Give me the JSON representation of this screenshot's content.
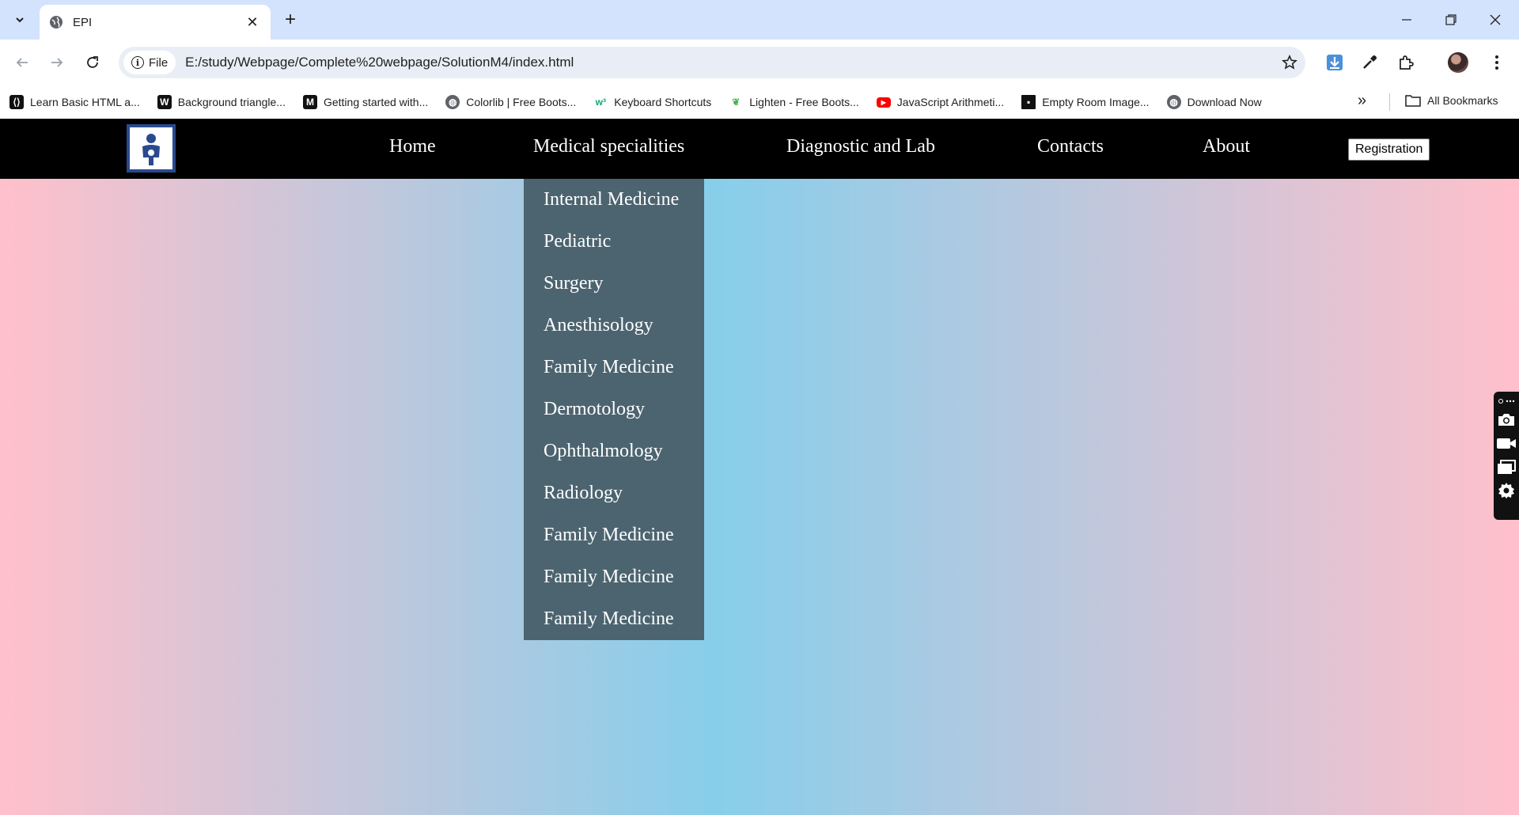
{
  "browser": {
    "tab_title": "EPI",
    "url_chip": "File",
    "url": "E:/study/Webpage/Complete%20webpage/SolutionM4/index.html",
    "bookmarks": [
      {
        "label": "Learn Basic HTML a...",
        "icon": "bracket-icon",
        "color": "#111111"
      },
      {
        "label": "Background triangle...",
        "icon": "w-icon",
        "color": "#111111"
      },
      {
        "label": "Getting started with...",
        "icon": "m-icon",
        "color": "#111111"
      },
      {
        "label": "Colorlib | Free Boots...",
        "icon": "globe-icon",
        "color": "#5f6368"
      },
      {
        "label": "Keyboard Shortcuts",
        "icon": "w3-icon",
        "color": "#04aa6d"
      },
      {
        "label": "Lighten - Free Boots...",
        "icon": "leaf-icon",
        "color": "#4caf50"
      },
      {
        "label": "JavaScript Arithmeti...",
        "icon": "youtube-icon",
        "color": "#ff0000"
      },
      {
        "label": "Empty Room Image...",
        "icon": "square-icon",
        "color": "#111111"
      },
      {
        "label": "Download Now",
        "icon": "globe-icon",
        "color": "#5f6368"
      }
    ],
    "all_bookmarks": "All Bookmarks"
  },
  "site": {
    "nav": {
      "home": "Home",
      "medical": "Medical specialities",
      "diagnostic": "Diagnostic and Lab",
      "contacts": "Contacts",
      "about": "About",
      "registration": "Registration"
    },
    "dropdown": [
      "Internal Medicine",
      "Pediatric",
      "Surgery",
      "Anesthisology",
      "Family Medicine",
      "Dermotology",
      "Ophthalmology",
      "Radiology",
      "Family Medicine",
      "Family Medicine",
      "Family Medicine"
    ],
    "colors": {
      "nav_bg": "#000000",
      "dropdown_bg": "#4c6470",
      "gradient_edge": "#ffc0cb",
      "gradient_center": "#87ceeb"
    }
  }
}
